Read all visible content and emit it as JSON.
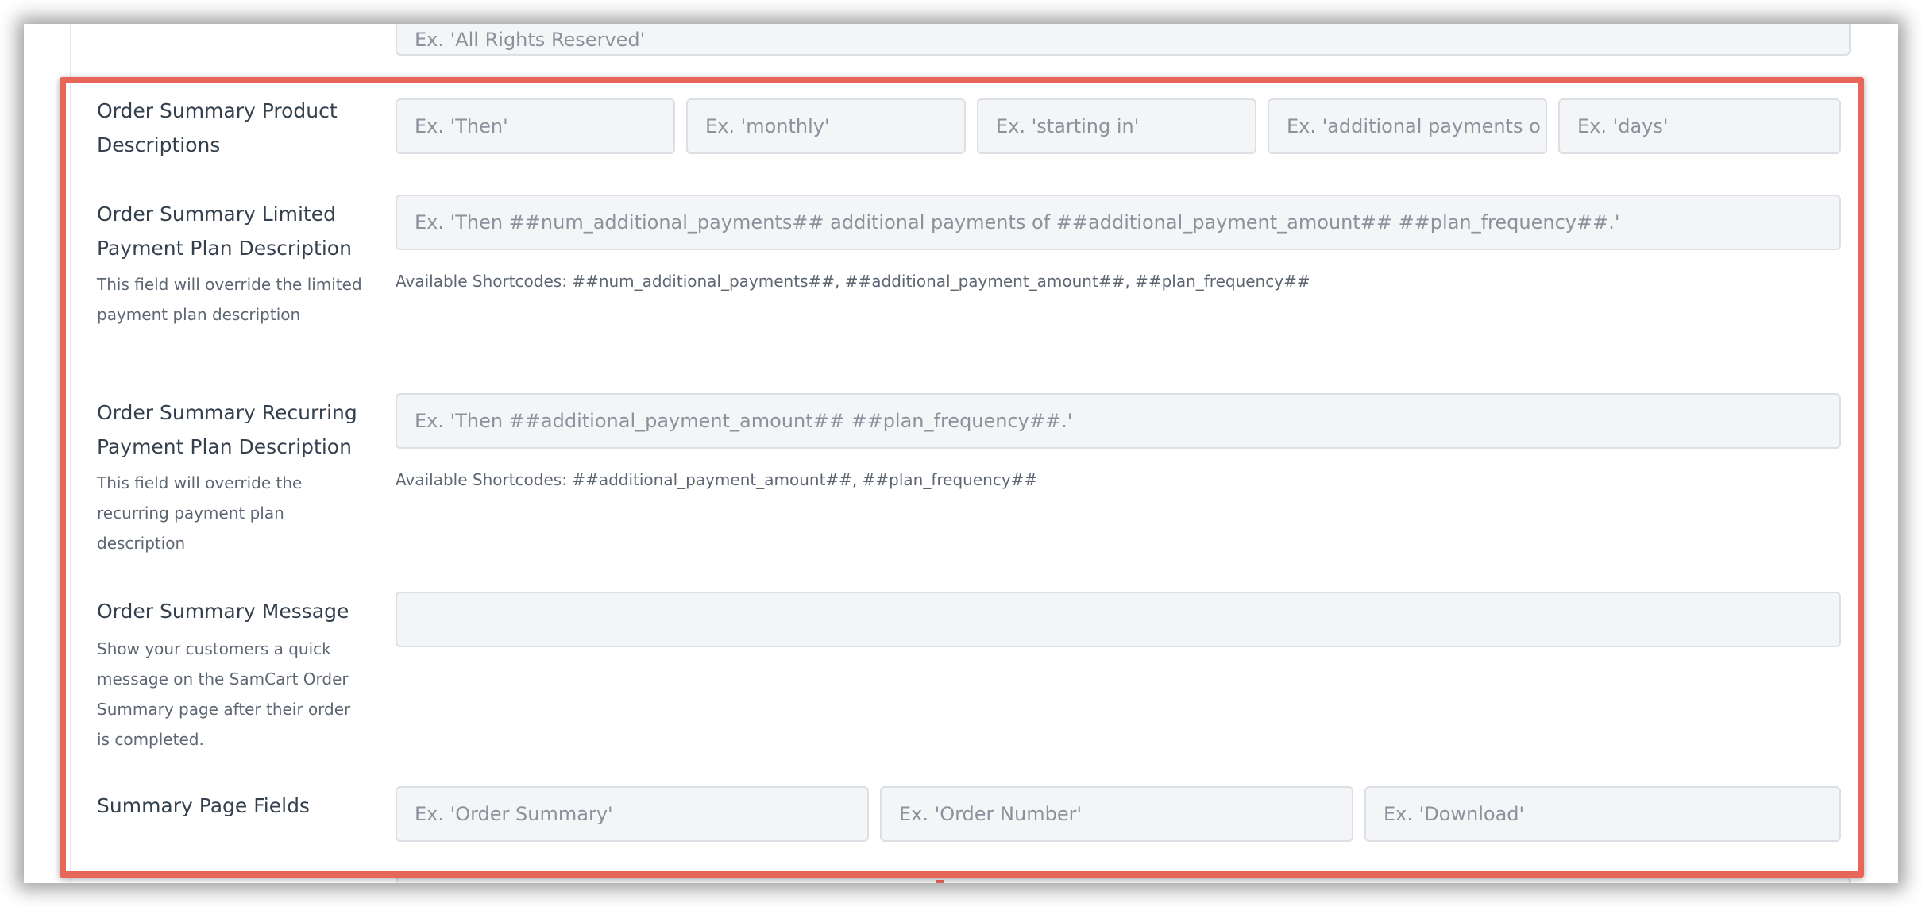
{
  "top_field": {
    "placeholder": "Ex. 'All Rights Reserved'"
  },
  "product_descriptions": {
    "label": "Order Summary Product Descriptions",
    "placeholders": [
      "Ex. 'Then'",
      "Ex. 'monthly'",
      "Ex. 'starting in'",
      "Ex. 'additional payments o",
      "Ex. 'days'"
    ]
  },
  "limited_plan": {
    "label": "Order Summary Limited Payment Plan Description",
    "help": "This field will override the limited payment plan description",
    "placeholder": "Ex. 'Then ##num_additional_payments## additional payments of ##additional_payment_amount## ##plan_frequency##.'",
    "shortcodes": "Available Shortcodes: ##num_additional_payments##, ##additional_payment_amount##, ##plan_frequency##"
  },
  "recurring_plan": {
    "label": "Order Summary Recurring Payment Plan Description",
    "help": "This field will override the recurring payment plan description",
    "placeholder": "Ex. 'Then ##additional_payment_amount## ##plan_frequency##.'",
    "shortcodes": "Available Shortcodes: ##additional_payment_amount##, ##plan_frequency##"
  },
  "summary_message": {
    "label": "Order Summary Message",
    "help": "Show your customers a quick message on the SamCart Order Summary page after their order is completed.",
    "placeholder": ""
  },
  "summary_page_fields": {
    "label": "Summary Page Fields",
    "placeholders": [
      "Ex. 'Order Summary'",
      "Ex. 'Order Number'",
      "Ex. 'Download'"
    ]
  },
  "colors": {
    "highlight": "#e8655a",
    "input_bg": "#f4f5f7",
    "input_border": "#dcdfe4",
    "label": "#34404d"
  }
}
